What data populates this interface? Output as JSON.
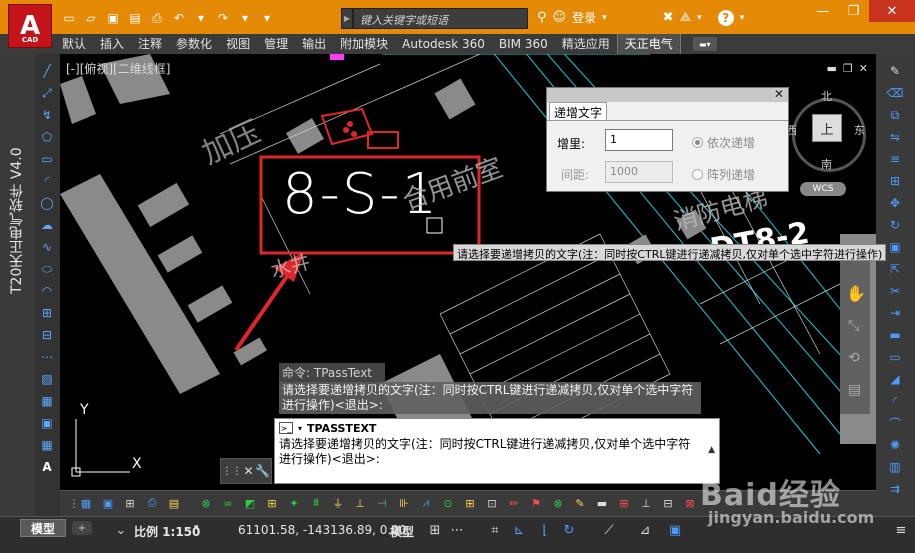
{
  "title_bar": {
    "logo_letter": "A",
    "logo_sub": "CAD",
    "search_placeholder": "键入关键字或短语",
    "login_label": "登录",
    "help_label": "?"
  },
  "menu": {
    "items": [
      "默认",
      "插入",
      "注释",
      "参数化",
      "视图",
      "管理",
      "输出",
      "附加模块",
      "Autodesk 360",
      "BIM 360",
      "精选应用",
      "天正电气"
    ],
    "active_index": 11
  },
  "left_panel": {
    "title": "T20天正电气软件 V4.0"
  },
  "canvas": {
    "viewport_label": "[-][俯视][二维线框]",
    "drawing_text": "8-S-1",
    "floor_text_1": "合用前室",
    "floor_text_2": "消防电梯",
    "floor_text_3": "DT8-2",
    "floor_text_4": "加压",
    "floor_text_5": "水井",
    "compass_north": "北",
    "compass_south": "南",
    "compass_east": "东",
    "compass_west": "西",
    "compass_top": "上",
    "wcs_label": "WCS",
    "axis_x": "X",
    "axis_y": "Y"
  },
  "dialog": {
    "tab": "递增文字",
    "increment_label": "增里:",
    "increment_value": "1",
    "spacing_label": "间距:",
    "spacing_value": "1000",
    "option_sequential": "依次递增",
    "option_array": "阵列递增",
    "selected_option": "sequential"
  },
  "cursor_tip": "请选择要递增拷贝的文字(注：同时按CTRL键进行递减拷贝,仅对单个选中字符进行操作)",
  "command": {
    "history_command": "命令: TPassText",
    "history_prompt": "请选择要递增拷贝的文字(注：同时按CTRL键进行递减拷贝,仅对单个选中字符进行操作)<退出>:",
    "current_command": "TPASSTEXT",
    "current_prompt": "请选择要递增拷贝的文字(注：同时按CTRL键进行递减拷贝,仅对单个选中字符进行操作)<退出>:"
  },
  "status_bar": {
    "model_tab": "模型",
    "scale_label": "比例 1:150",
    "coordinates": "61101.58, -143136.89, 0.00",
    "space_label": "模型"
  },
  "watermark": {
    "brand": "Baid经验",
    "url": "jingyan.baidu.com"
  },
  "colors": {
    "title_bar": "#e58a06",
    "annotation_red": "#e0262a",
    "wall_gray": "#8a8a8a",
    "cyan_lines": "#1ec8d8",
    "text_white": "#ffffff"
  }
}
